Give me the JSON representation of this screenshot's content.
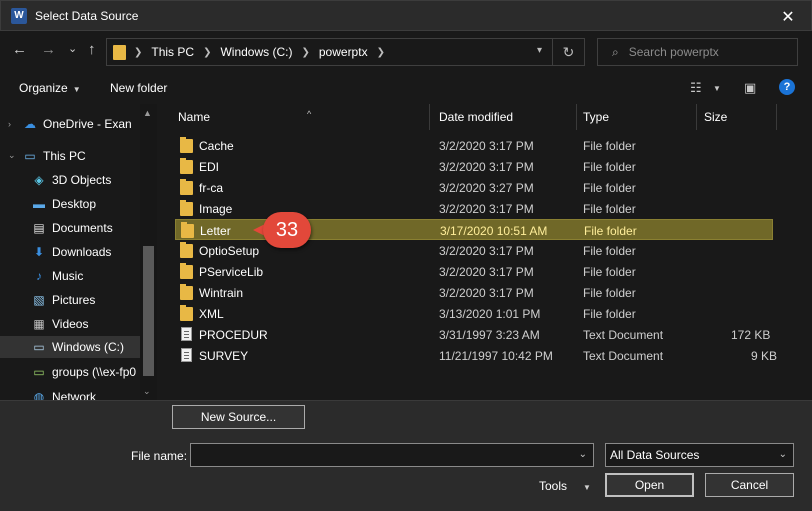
{
  "window": {
    "title": "Select Data Source",
    "app_icon": "W",
    "close": "✕"
  },
  "nav": {
    "back": "←",
    "forward": "→",
    "recent": "⌄",
    "up": "↑",
    "breadcrumb": [
      "This PC",
      "Windows (C:)",
      "powerptx"
    ],
    "refresh": "↻",
    "search_placeholder": "Search powerptx"
  },
  "toolbar": {
    "organize": "Organize",
    "new_folder": "New folder",
    "help": "?"
  },
  "sidebar": {
    "items": [
      {
        "label": "OneDrive - Exan",
        "icon": "cloud-icon"
      },
      {
        "label": "This PC",
        "icon": "computer-icon"
      },
      {
        "label": "3D Objects",
        "icon": "cube-icon"
      },
      {
        "label": "Desktop",
        "icon": "desktop-icon"
      },
      {
        "label": "Documents",
        "icon": "documents-icon"
      },
      {
        "label": "Downloads",
        "icon": "download-icon"
      },
      {
        "label": "Music",
        "icon": "music-icon"
      },
      {
        "label": "Pictures",
        "icon": "pictures-icon"
      },
      {
        "label": "Videos",
        "icon": "videos-icon"
      },
      {
        "label": "Windows (C:)",
        "icon": "drive-icon"
      },
      {
        "label": "groups (\\\\ex-fp0",
        "icon": "network-drive-icon"
      },
      {
        "label": "Network",
        "icon": "network-icon"
      }
    ]
  },
  "columns": {
    "name": "Name",
    "date": "Date modified",
    "type": "Type",
    "size": "Size"
  },
  "files": [
    {
      "name": "Cache",
      "date": "3/2/2020 3:17 PM",
      "type": "File folder",
      "size": "",
      "kind": "folder"
    },
    {
      "name": "EDI",
      "date": "3/2/2020 3:17 PM",
      "type": "File folder",
      "size": "",
      "kind": "folder"
    },
    {
      "name": "fr-ca",
      "date": "3/2/2020 3:27 PM",
      "type": "File folder",
      "size": "",
      "kind": "folder"
    },
    {
      "name": "Image",
      "date": "3/2/2020 3:17 PM",
      "type": "File folder",
      "size": "",
      "kind": "folder"
    },
    {
      "name": "Letter",
      "date": "3/17/2020 10:51 AM",
      "type": "File folder",
      "size": "",
      "kind": "folder"
    },
    {
      "name": "OptioSetup",
      "date": "3/2/2020 3:17 PM",
      "type": "File folder",
      "size": "",
      "kind": "folder"
    },
    {
      "name": "PServiceLib",
      "date": "3/2/2020 3:17 PM",
      "type": "File folder",
      "size": "",
      "kind": "folder"
    },
    {
      "name": "Wintrain",
      "date": "3/2/2020 3:17 PM",
      "type": "File folder",
      "size": "",
      "kind": "folder"
    },
    {
      "name": "XML",
      "date": "3/13/2020 1:01 PM",
      "type": "File folder",
      "size": "",
      "kind": "folder"
    },
    {
      "name": "PROCEDUR",
      "date": "3/31/1997 3:23 AM",
      "type": "Text Document",
      "size": "172 KB",
      "kind": "doc"
    },
    {
      "name": "SURVEY",
      "date": "11/21/1997 10:42 PM",
      "type": "Text Document",
      "size": "9 KB",
      "kind": "doc"
    }
  ],
  "callout": {
    "number": "33"
  },
  "bottom": {
    "new_source": "New Source...",
    "file_name_label": "File name:",
    "file_name_value": "",
    "filter_value": "All Data Sources",
    "tools": "Tools",
    "open": "Open",
    "cancel": "Cancel"
  },
  "colors": {
    "highlight_row": "#706828",
    "callout": "#e2483a",
    "folder": "#e8b845",
    "help": "#1a73d6"
  }
}
